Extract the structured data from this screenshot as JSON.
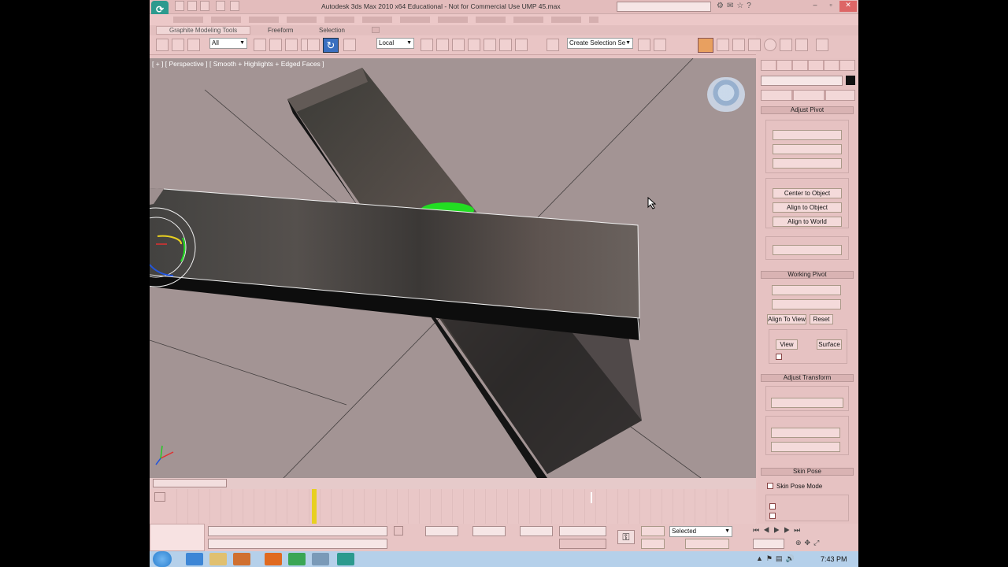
{
  "titlebar": {
    "title": "Autodesk 3ds Max 2010 x64  Educational - Not for Commercial Use   UMP 45.max"
  },
  "ribbon": {
    "tabs": [
      "Graphite Modeling Tools",
      "Freeform",
      "Selection"
    ]
  },
  "toolbar": {
    "filter_value": "All",
    "coord_value": "Local",
    "selection_set_placeholder": "Create Selection Se"
  },
  "viewport": {
    "label": "[ + ] [ Perspective ] [ Smooth + Highlights + Edged Faces ]"
  },
  "command_panel": {
    "adjust_pivot": {
      "header": "Adjust Pivot",
      "alignment": {
        "buttons": [
          "Center to Object",
          "Align to Object",
          "Align to World"
        ]
      }
    },
    "working_pivot": {
      "header": "Working Pivot",
      "buttons": [
        "Align To View",
        "Reset",
        "View",
        "Surface"
      ]
    },
    "adjust_transform": {
      "header": "Adjust Transform"
    },
    "skin_pose": {
      "header": "Skin Pose",
      "checkbox_label": "Skin Pose Mode"
    }
  },
  "status": {
    "selected_value": "Selected"
  },
  "taskbar": {
    "clock": "7:43 PM",
    "colors": {
      "start": "#2a7fd0",
      "bar": "#b5d0ea"
    }
  },
  "colors": {
    "accent": "#e7c3c3",
    "viewport_bg": "#a39494",
    "pivot_green": "#22dd22"
  }
}
